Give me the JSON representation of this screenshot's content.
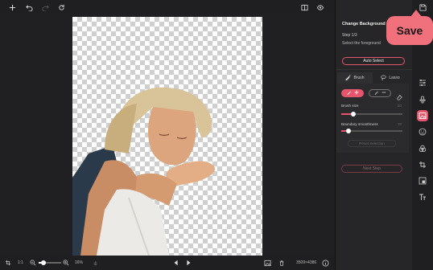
{
  "topbar": {
    "icons": [
      "add-icon",
      "undo-icon",
      "redo-icon",
      "reset-icon",
      "compare-icon",
      "preview-eye-icon",
      "save-disk-icon"
    ]
  },
  "save_callout": {
    "label": "Save"
  },
  "bottombar": {
    "ratio_label": "1:1",
    "zoom_value": "16%",
    "zoom_level": 0.2,
    "dimensions": "3509×4386"
  },
  "panel": {
    "title": "Change Background",
    "step": "Step 1/3",
    "step_description": "Select the foreground",
    "auto_select_label": "Auto Select",
    "tabs": [
      {
        "label": "Brush",
        "icon": "brush-icon"
      },
      {
        "label": "Lasso",
        "icon": "lasso-icon"
      }
    ],
    "brush_size_label": "Brush size",
    "brush_size_value": "50",
    "brush_size_level": 0.2,
    "boundary_label": "Boundary smoothness",
    "boundary_value": "10",
    "boundary_level": 0.12,
    "reset_label": "Reset Selection",
    "next_label": "Next Step"
  },
  "colors": {
    "accent": "#e5566d",
    "callout": "#f0707c",
    "panel_bg": "#262628",
    "canvas_bg": "#202022"
  }
}
